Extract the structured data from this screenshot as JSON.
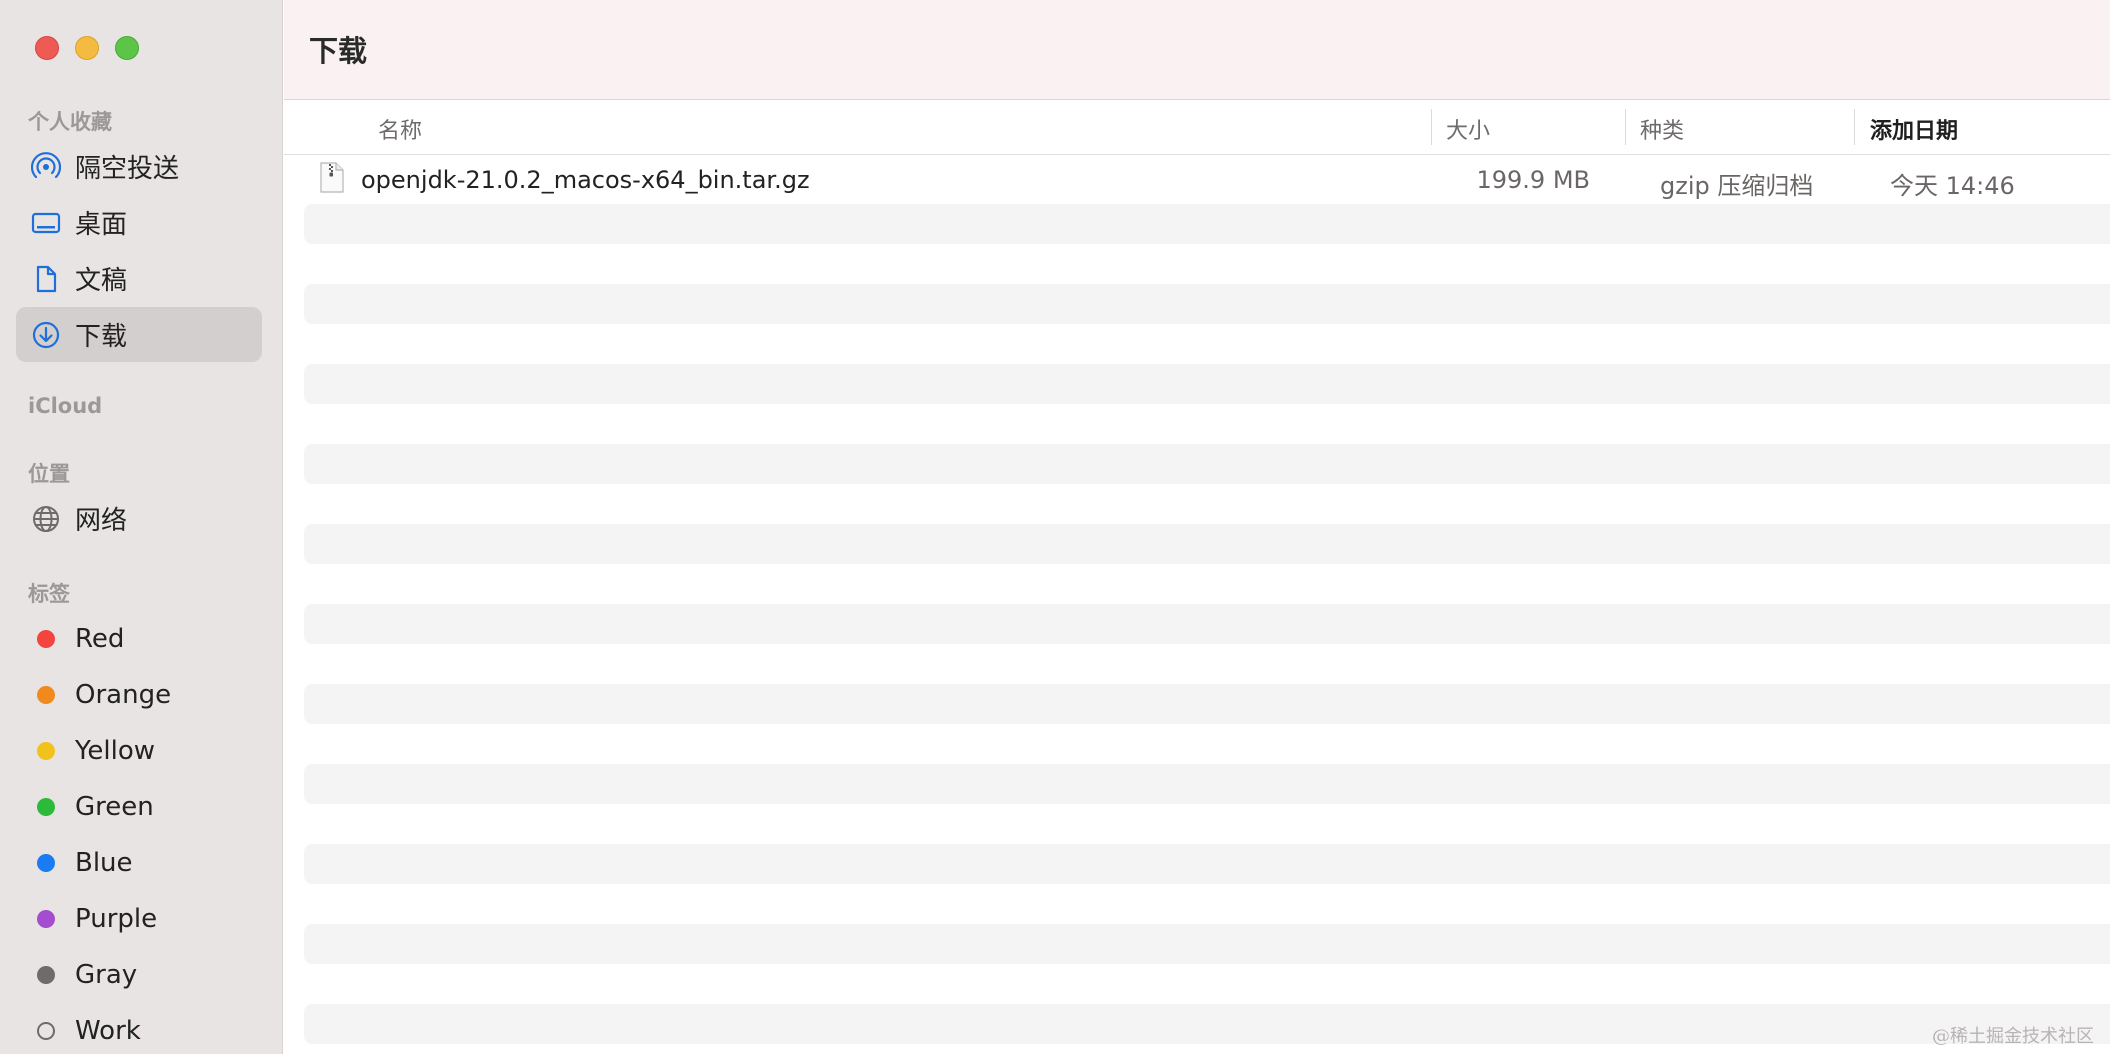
{
  "window": {
    "title": "下载"
  },
  "sidebar": {
    "sections": {
      "favorites": "个人收藏",
      "icloud": "iCloud",
      "locations": "位置",
      "tags": "标签"
    },
    "favorites": [
      {
        "label": "隔空投送",
        "icon": "airdrop-icon"
      },
      {
        "label": "桌面",
        "icon": "desktop-icon"
      },
      {
        "label": "文稿",
        "icon": "document-icon"
      },
      {
        "label": "下载",
        "icon": "download-icon",
        "active": true
      }
    ],
    "locations": [
      {
        "label": "网络",
        "icon": "network-globe-icon"
      }
    ],
    "tags": [
      {
        "label": "Red",
        "color": "#f2453d"
      },
      {
        "label": "Orange",
        "color": "#f08a1c"
      },
      {
        "label": "Yellow",
        "color": "#f1c21b"
      },
      {
        "label": "Green",
        "color": "#2dba3a"
      },
      {
        "label": "Blue",
        "color": "#1a7cf3"
      },
      {
        "label": "Purple",
        "color": "#a54dcf"
      },
      {
        "label": "Gray",
        "color": "#6e6b6b"
      },
      {
        "label": "Work",
        "color": "none"
      }
    ]
  },
  "columns": {
    "name": "名称",
    "size": "大小",
    "kind": "种类",
    "date_added": "添加日期"
  },
  "files": [
    {
      "name": "openjdk-21.0.2_macos-x64_bin.tar.gz",
      "size": "199.9 MB",
      "kind": "gzip 压缩归档",
      "date_added": "今天 14:46",
      "icon": "archive-file-icon"
    }
  ],
  "watermark": "@稀土掘金技术社区"
}
